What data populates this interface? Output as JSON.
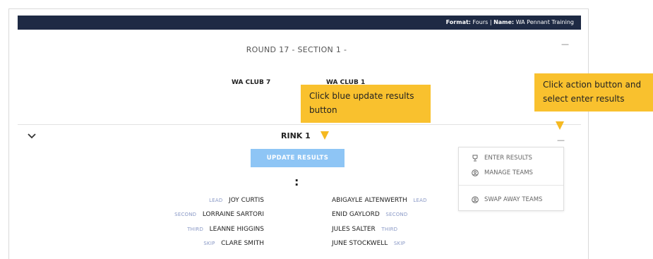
{
  "header": {
    "format_label": "Format:",
    "format_value": "Fours",
    "separator": " | ",
    "name_label": "Name:",
    "name_value": "WA Pennant Training"
  },
  "round": {
    "title": "ROUND 17 - SECTION 1 -",
    "collapse_glyph": "—"
  },
  "clubs": {
    "home": "WA CLUB 7",
    "away": "WA CLUB 1"
  },
  "tooltips": {
    "update": "Click blue update results\nbutton",
    "action": "Click action button and\nselect enter results"
  },
  "rink": {
    "title": "RINK 1",
    "update_button": "UPDATE RESULTS",
    "vs_separator": ":",
    "action_glyph": "—"
  },
  "action_menu": {
    "items": [
      {
        "label": "ENTER RESULTS",
        "icon": "trophy-icon"
      },
      {
        "label": "MANAGE TEAMS",
        "icon": "user-circle-icon"
      },
      {
        "label": "SWAP AWAY TEAMS",
        "icon": "user-circle-icon"
      }
    ]
  },
  "home_players": [
    {
      "position": "LEAD",
      "name": "JOY CURTIS"
    },
    {
      "position": "SECOND",
      "name": "LORRAINE SARTORI"
    },
    {
      "position": "THIRD",
      "name": "LEANNE HIGGINS"
    },
    {
      "position": "SKIP",
      "name": "CLARE SMITH"
    }
  ],
  "away_players": [
    {
      "position": "LEAD",
      "name": "ABIGAYLE ALTENWERTH"
    },
    {
      "position": "SECOND",
      "name": "ENID GAYLORD"
    },
    {
      "position": "THIRD",
      "name": "JULES SALTER"
    },
    {
      "position": "SKIP",
      "name": "JUNE STOCKWELL"
    }
  ],
  "colors": {
    "header_bg": "#1e2a44",
    "tooltip_bg": "#f9c12e",
    "update_button_bg": "#8ec5f5",
    "position_label": "#8a99c6"
  }
}
